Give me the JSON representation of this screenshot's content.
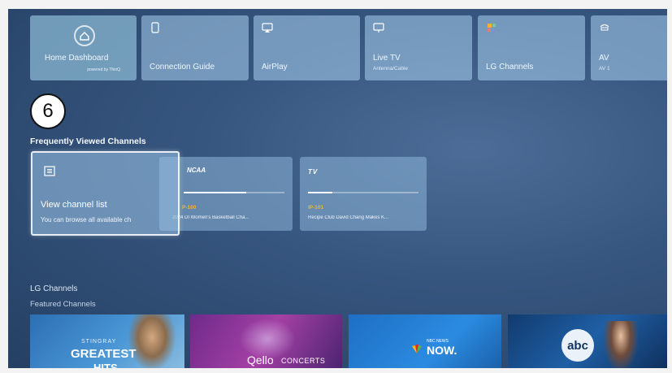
{
  "tiles": [
    {
      "name": "home-dashboard",
      "label": "Home Dashboard",
      "sub": "powered by ThinQ"
    },
    {
      "name": "connection-guide",
      "label": "Connection Guide"
    },
    {
      "name": "airplay",
      "label": "AirPlay"
    },
    {
      "name": "live-tv",
      "label": "Live TV",
      "sub": "Antenna/Cable"
    },
    {
      "name": "lg-channels",
      "label": "LG Channels"
    },
    {
      "name": "av",
      "label": "AV",
      "sub": "AV 1"
    }
  ],
  "step_badge": "6",
  "frequently_viewed": {
    "title": "Frequently Viewed Channels",
    "focus_card": {
      "title": "View channel list",
      "desc": "You can browse all available ch"
    },
    "cards": [
      {
        "logo": "NCAA",
        "number": "P-100",
        "desc": "2024 DI Women's Basketball Cha...",
        "progress": 0.62
      },
      {
        "logo": "TV",
        "number": "IP-101",
        "desc": "Recipe Club David Chang Makes K...",
        "progress": 0.22
      }
    ]
  },
  "lg_channels": {
    "title": "LG Channels",
    "subtitle": "Featured Channels",
    "thumbs": [
      {
        "name": "stingray",
        "top": "STINGRAY",
        "main": "GREATEST",
        "tail": "HITS"
      },
      {
        "name": "qello",
        "main": "Qello",
        "tail": "CONCERTS"
      },
      {
        "name": "nbc-news-now",
        "top": "NBC NEWS",
        "main": "NOW."
      },
      {
        "name": "abc-news",
        "main": "abc"
      }
    ]
  },
  "colors": {
    "accent_orange": "#f2b23a",
    "tile_blue": "#9ac8ec"
  }
}
